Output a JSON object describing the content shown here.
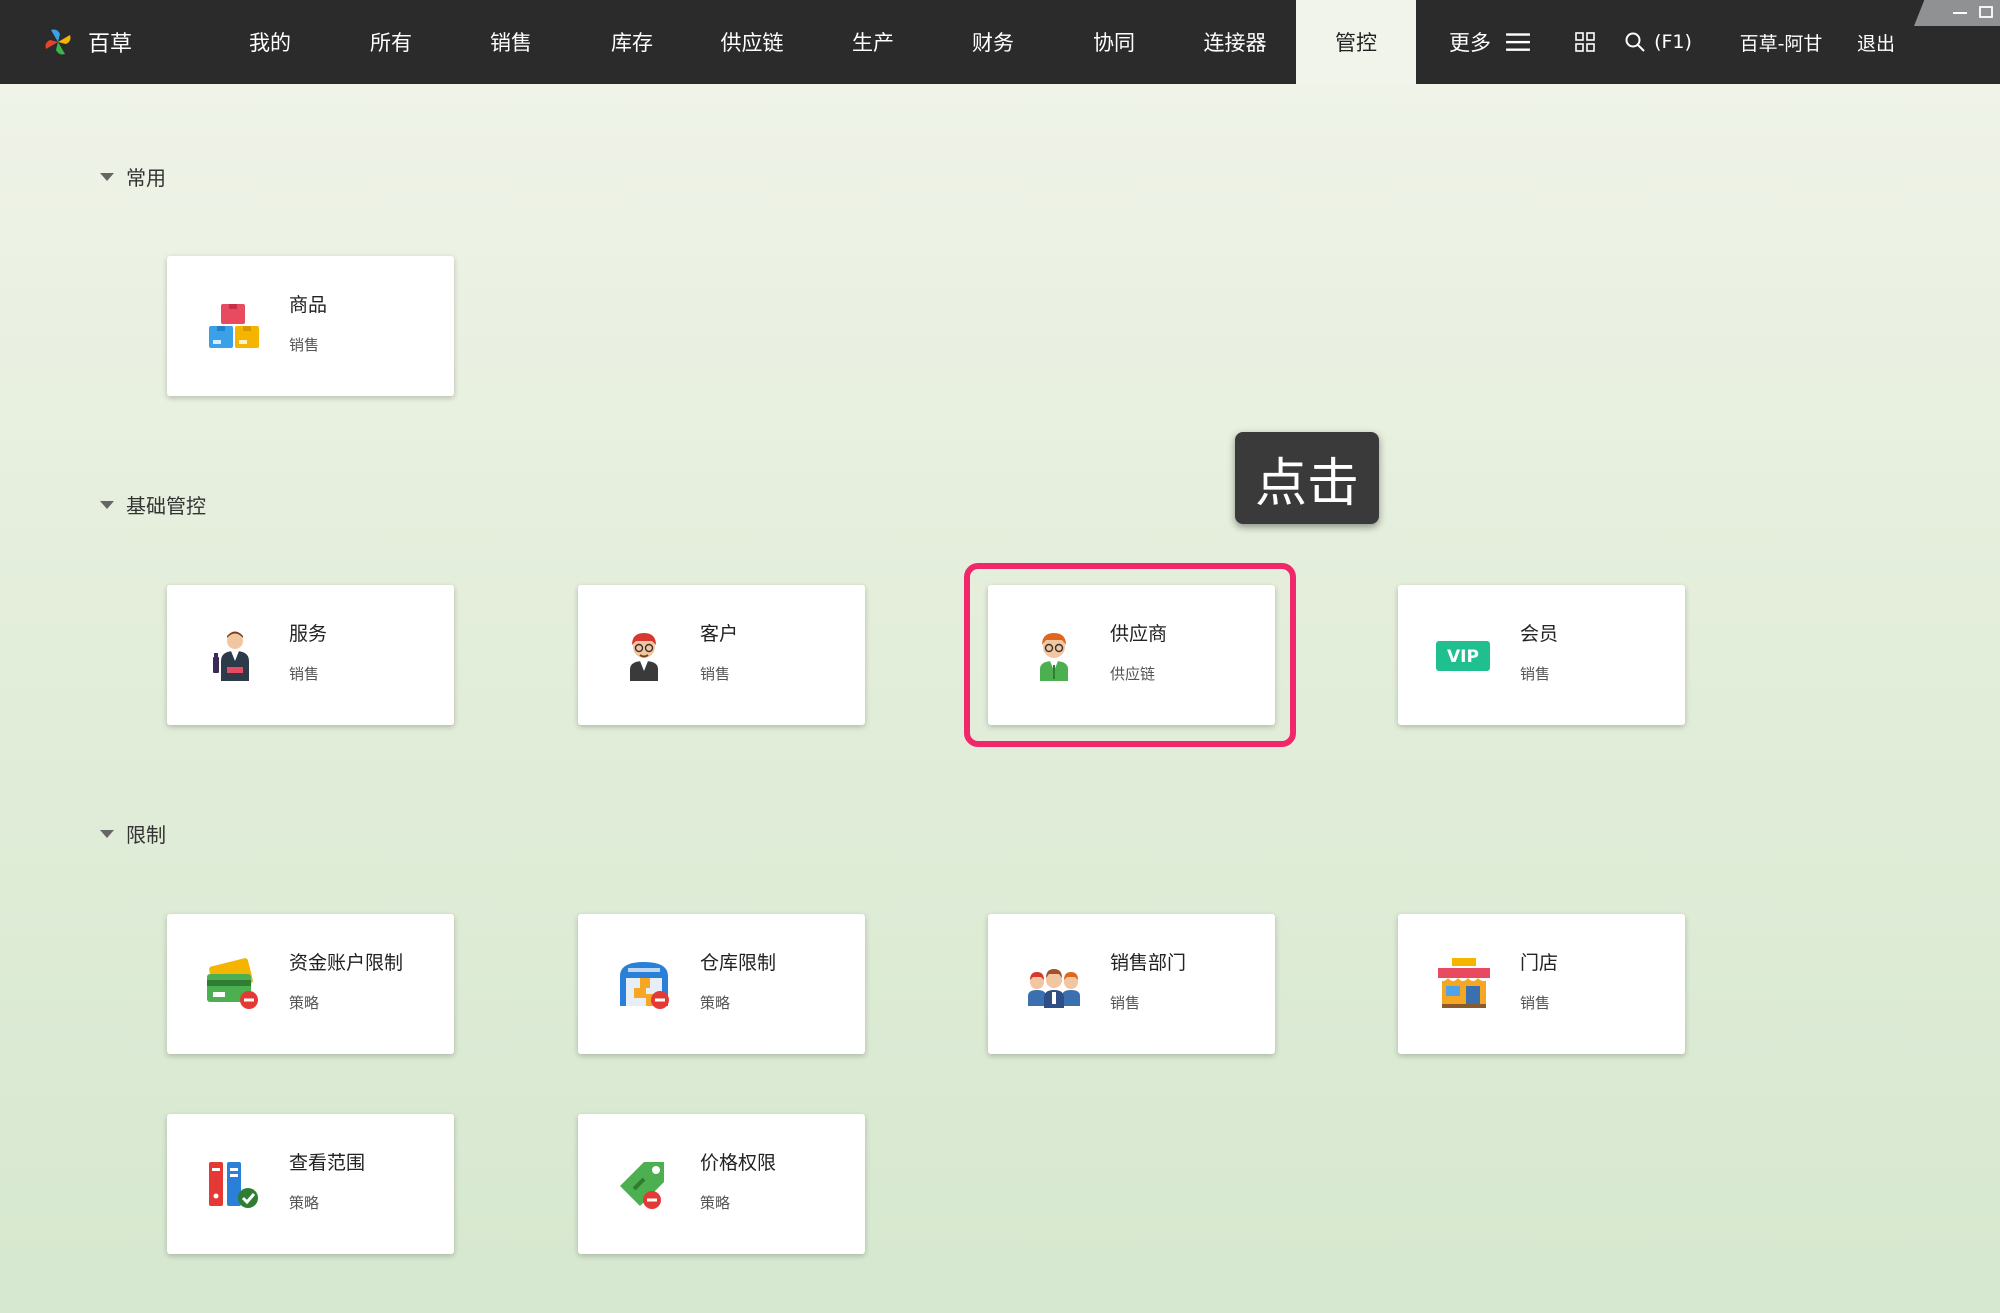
{
  "app": {
    "brand_name": "百草",
    "search_shortcut": "(F1)",
    "user_name": "百草-阿甘",
    "logout_label": "退出",
    "more_label": "更多"
  },
  "nav": {
    "items": [
      "我的",
      "所有",
      "销售",
      "库存",
      "供应链",
      "生产",
      "财务",
      "协同",
      "连接器",
      "管控"
    ],
    "active": "管控"
  },
  "sections": [
    {
      "title": "常用",
      "cards": [
        {
          "title": "商品",
          "subtitle": "销售",
          "icon": "goods-boxes-icon"
        }
      ]
    },
    {
      "title": "基础管控",
      "cards": [
        {
          "title": "服务",
          "subtitle": "销售",
          "icon": "waiter-icon"
        },
        {
          "title": "客户",
          "subtitle": "销售",
          "icon": "customer-avatar-icon"
        },
        {
          "title": "供应商",
          "subtitle": "供应链",
          "icon": "supplier-avatar-icon"
        },
        {
          "title": "会员",
          "subtitle": "销售",
          "icon": "vip-badge-icon",
          "icon_text": "VIP"
        }
      ]
    },
    {
      "title": "限制",
      "cards": [
        {
          "title": "资金账户限制",
          "subtitle": "策略",
          "icon": "credit-card-restrict-icon"
        },
        {
          "title": "仓库限制",
          "subtitle": "策略",
          "icon": "warehouse-restrict-icon"
        },
        {
          "title": "销售部门",
          "subtitle": "销售",
          "icon": "sales-team-icon"
        },
        {
          "title": "门店",
          "subtitle": "销售",
          "icon": "store-icon"
        },
        {
          "title": "查看范围",
          "subtitle": "策略",
          "icon": "binders-check-icon"
        },
        {
          "title": "价格权限",
          "subtitle": "策略",
          "icon": "price-tag-restrict-icon"
        }
      ]
    }
  ],
  "overlay": {
    "tooltip_text": "点击",
    "highlighted_card": "供应商"
  },
  "colors": {
    "topbar": "#2b2b2b",
    "highlight": "#f0286a",
    "tooltip_bg": "#3a3a3a",
    "vip_green": "#1fbf8f"
  }
}
